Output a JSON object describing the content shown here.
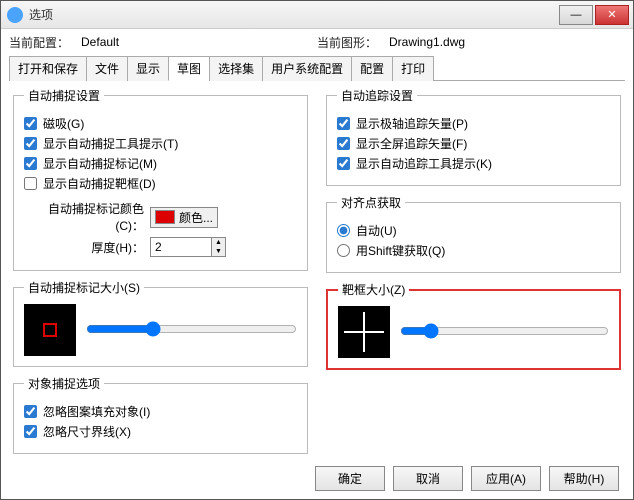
{
  "window": {
    "title": "选项"
  },
  "toprow": {
    "profile_label": "当前配置：",
    "profile_value": "Default",
    "drawing_label": "当前图形：",
    "drawing_value": "Drawing1.dwg"
  },
  "tabs": [
    "打开和保存",
    "文件",
    "显示",
    "草图",
    "选择集",
    "用户系统配置",
    "配置",
    "打印"
  ],
  "active_tab": 3,
  "snap": {
    "legend": "自动捕捉设置",
    "magnet": "磁吸(G)",
    "tooltip": "显示自动捕捉工具提示(T)",
    "marker": "显示自动捕捉标记(M)",
    "aperture": "显示自动捕捉靶框(D)",
    "color_label": "自动捕捉标记颜色(C)：",
    "color_btn": "颜色...",
    "thickness_label": "厚度(H)：",
    "thickness_value": "2"
  },
  "markersize": {
    "legend": "自动捕捉标记大小(S)"
  },
  "objsnap": {
    "legend": "对象捕捉选项",
    "ignore_hatch": "忽略图案填充对象(I)",
    "ignore_dim": "忽略尺寸界线(X)"
  },
  "track": {
    "legend": "自动追踪设置",
    "polar": "显示极轴追踪矢量(P)",
    "fullscreen": "显示全屏追踪矢量(F)",
    "tooltip": "显示自动追踪工具提示(K)"
  },
  "align": {
    "legend": "对齐点获取",
    "auto": "自动(U)",
    "shift": "用Shift键获取(Q)"
  },
  "targetsize": {
    "legend": "靶框大小(Z)"
  },
  "footer": {
    "ok": "确定",
    "cancel": "取消",
    "apply": "应用(A)",
    "help": "帮助(H)"
  }
}
